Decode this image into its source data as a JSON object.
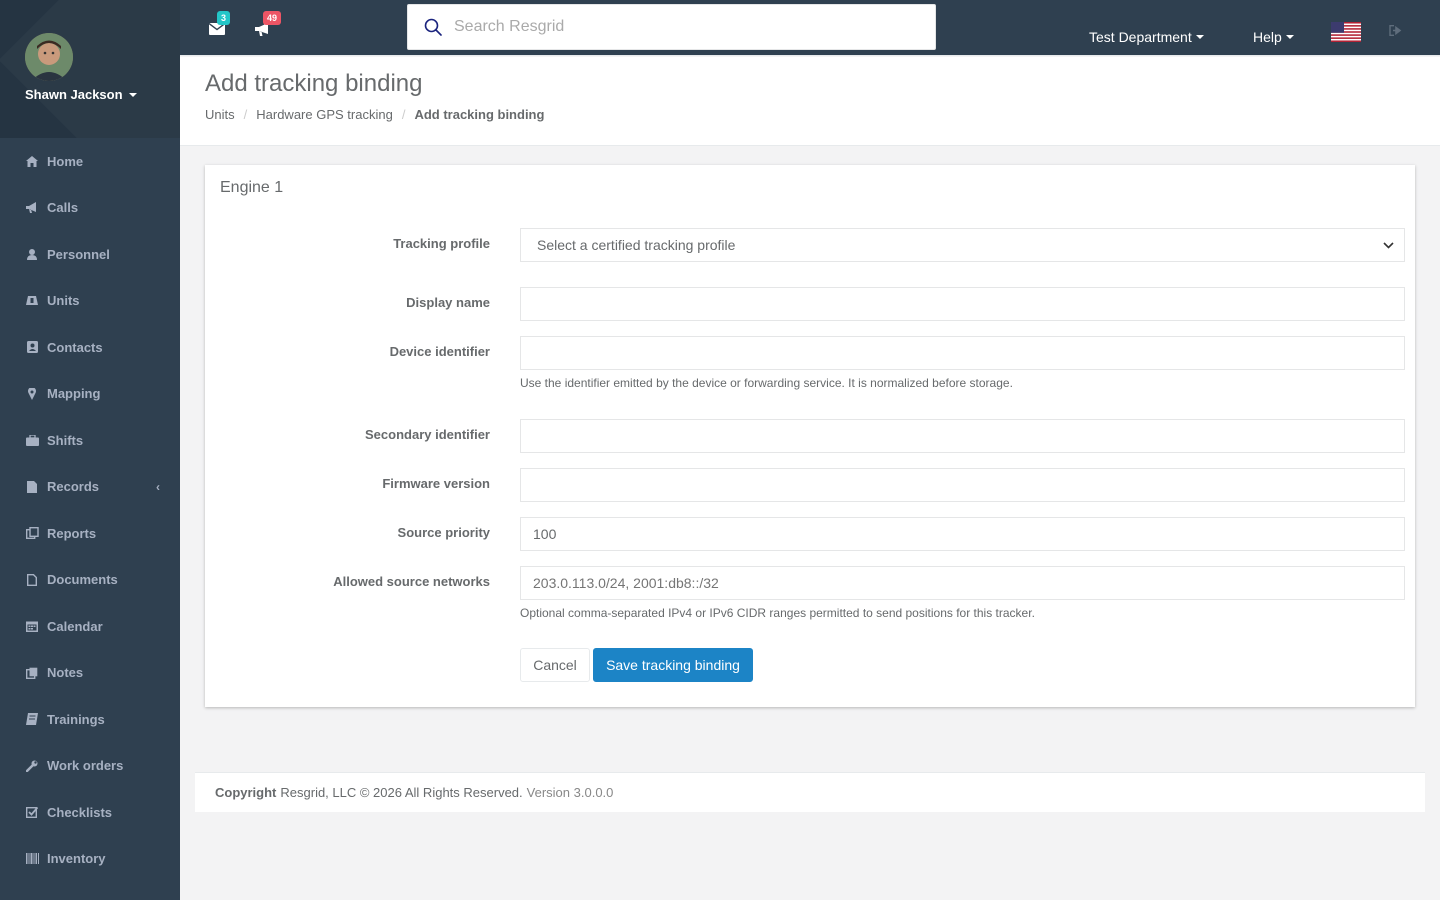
{
  "user": {
    "name": "Shawn Jackson"
  },
  "sidebar": {
    "items": [
      {
        "label": "Home",
        "icon": "home-icon"
      },
      {
        "label": "Calls",
        "icon": "bullhorn-icon"
      },
      {
        "label": "Personnel",
        "icon": "user-icon"
      },
      {
        "label": "Units",
        "icon": "truck-icon"
      },
      {
        "label": "Contacts",
        "icon": "address-book-icon"
      },
      {
        "label": "Mapping",
        "icon": "map-marker-icon"
      },
      {
        "label": "Shifts",
        "icon": "briefcase-icon"
      },
      {
        "label": "Records",
        "icon": "file-icon",
        "expandable": true
      },
      {
        "label": "Reports",
        "icon": "report-icon"
      },
      {
        "label": "Documents",
        "icon": "document-icon"
      },
      {
        "label": "Calendar",
        "icon": "calendar-icon"
      },
      {
        "label": "Notes",
        "icon": "notes-icon"
      },
      {
        "label": "Trainings",
        "icon": "book-icon"
      },
      {
        "label": "Work orders",
        "icon": "wrench-icon"
      },
      {
        "label": "Checklists",
        "icon": "checkbox-icon"
      },
      {
        "label": "Inventory",
        "icon": "barcode-icon"
      }
    ]
  },
  "topbar": {
    "messages_count": "3",
    "calls_count": "49",
    "search_placeholder": "Search Resgrid",
    "department": "Test Department",
    "help": "Help",
    "colors": {
      "messages_badge": "#23c6c8",
      "calls_badge": "#ed5565"
    }
  },
  "header": {
    "title": "Add tracking binding",
    "breadcrumb": [
      "Units",
      "Hardware GPS tracking",
      "Add tracking binding"
    ]
  },
  "form": {
    "panel_title": "Engine 1",
    "tracking_profile": {
      "label": "Tracking profile",
      "selected": "Select a certified tracking profile"
    },
    "display_name": {
      "label": "Display name",
      "value": ""
    },
    "device_identifier": {
      "label": "Device identifier",
      "value": "",
      "help": "Use the identifier emitted by the device or forwarding service. It is normalized before storage."
    },
    "secondary_identifier": {
      "label": "Secondary identifier",
      "value": ""
    },
    "firmware_version": {
      "label": "Firmware version",
      "value": ""
    },
    "source_priority": {
      "label": "Source priority",
      "value": "100"
    },
    "allowed_networks": {
      "label": "Allowed source networks",
      "placeholder": "203.0.113.0/24, 2001:db8::/32",
      "help": "Optional comma-separated IPv4 or IPv6 CIDR ranges permitted to send positions for this tracker."
    },
    "cancel_label": "Cancel",
    "save_label": "Save tracking binding"
  },
  "footer": {
    "copyright_label": "Copyright",
    "copyright_text": "Resgrid, LLC © 2026 All Rights Reserved.",
    "version": "Version 3.0.0.0"
  }
}
